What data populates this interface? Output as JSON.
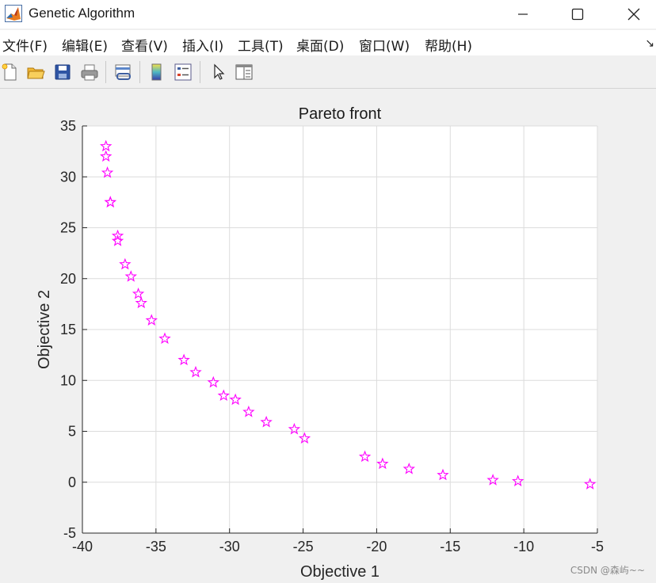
{
  "window": {
    "title": "Genetic Algorithm",
    "icons": [
      "matlab-logo-icon",
      "minimize-icon",
      "maximize-icon",
      "close-icon"
    ]
  },
  "menu": {
    "items": [
      "文件(F)",
      "编辑(E)",
      "查看(V)",
      "插入(I)",
      "工具(T)",
      "桌面(D)",
      "窗口(W)",
      "帮助(H)"
    ],
    "overflow_icon": "dock-arrow-icon"
  },
  "toolbar": {
    "icons": [
      "new-figure-icon",
      "open-file-icon",
      "save-icon",
      "print-icon",
      "link-plot-icon",
      "colorbar-icon",
      "legend-icon",
      "pointer-icon",
      "property-inspector-icon"
    ]
  },
  "watermark": "CSDN @森屿~~",
  "colors": {
    "marker": "#ff00ff",
    "grid": "#dcdcdc",
    "axes_bg": "#ffffff",
    "figure_bg": "#f0f0f0"
  },
  "chart_data": {
    "type": "scatter",
    "title": "Pareto front",
    "xlabel": "Objective 1",
    "ylabel": "Objective 2",
    "xlim": [
      -40,
      -5
    ],
    "ylim": [
      -5,
      35
    ],
    "xticks": [
      "-40",
      "-35",
      "-30",
      "-25",
      "-20",
      "-15",
      "-10",
      "-5"
    ],
    "yticks": [
      "-5",
      "0",
      "5",
      "10",
      "15",
      "20",
      "25",
      "30",
      "35"
    ],
    "grid": true,
    "marker": "pentagram",
    "x": [
      -38.4,
      -38.4,
      -38.3,
      -38.1,
      -38.1,
      -37.6,
      -37.6,
      -37.1,
      -36.7,
      -36.2,
      -36.0,
      -35.3,
      -34.4,
      -33.1,
      -32.3,
      -31.1,
      -30.4,
      -29.6,
      -28.7,
      -27.5,
      -25.6,
      -24.9,
      -20.8,
      -19.6,
      -17.8,
      -15.5,
      -12.1,
      -10.4,
      -5.5
    ],
    "y": [
      33.0,
      32.0,
      30.4,
      27.5,
      27.5,
      24.2,
      23.7,
      21.4,
      20.2,
      18.5,
      17.6,
      15.9,
      14.1,
      12.0,
      10.8,
      9.8,
      8.5,
      8.1,
      6.9,
      5.9,
      5.2,
      4.3,
      2.5,
      1.8,
      1.3,
      0.7,
      0.2,
      0.1,
      -0.2
    ]
  }
}
